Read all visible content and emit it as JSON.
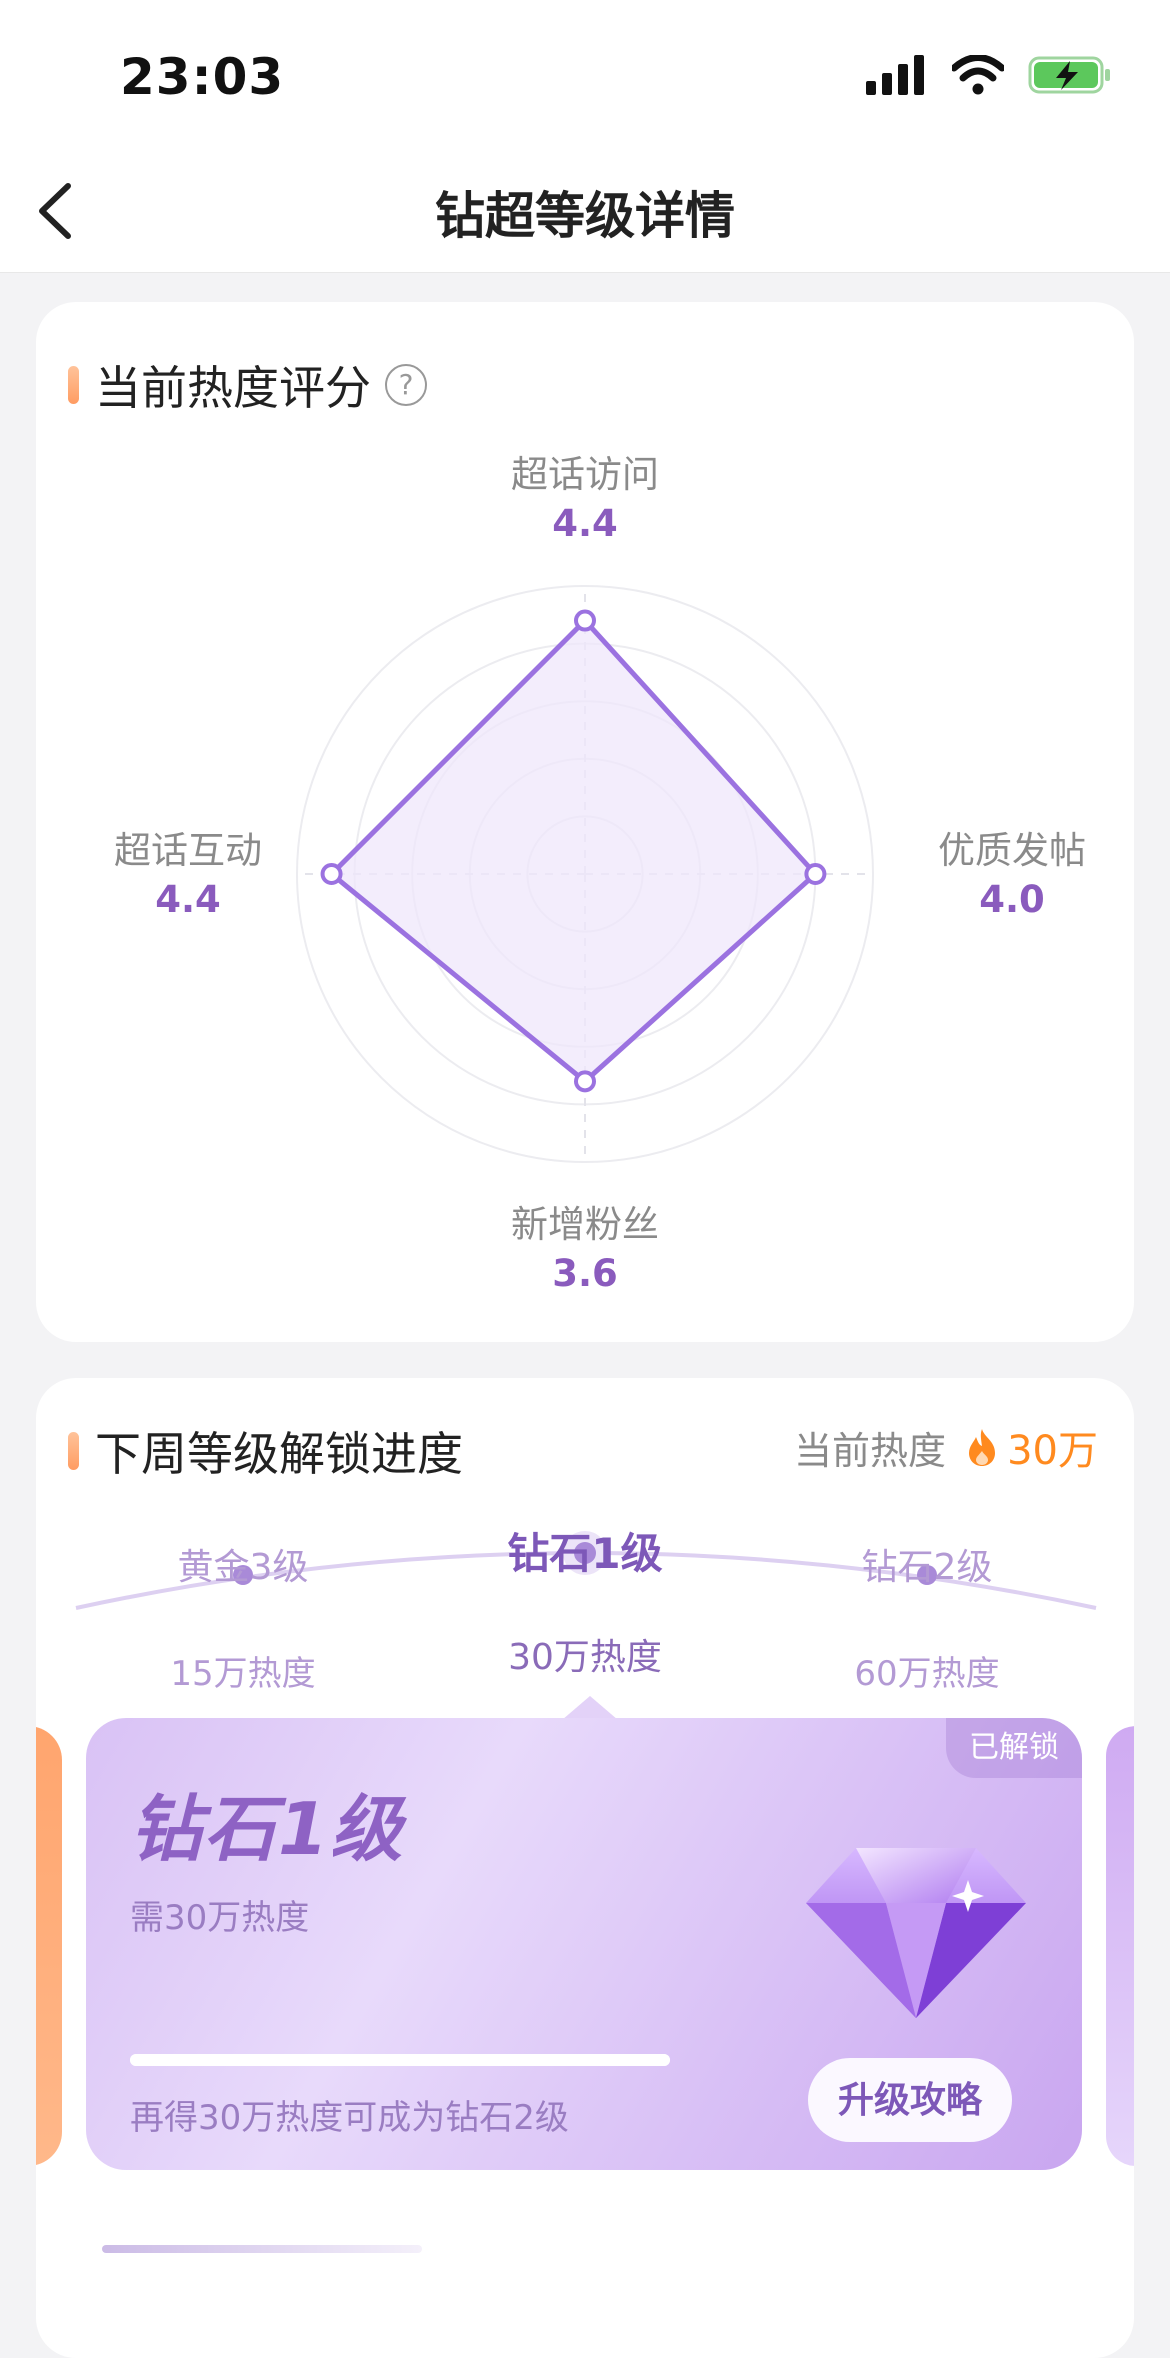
{
  "status_bar": {
    "time": "23:03"
  },
  "nav": {
    "title": "钻超等级详情"
  },
  "heat_score": {
    "title": "当前热度评分",
    "help_symbol": "?",
    "axes": [
      {
        "name": "超话访问",
        "value": "4.4"
      },
      {
        "name": "优质发帖",
        "value": "4.0"
      },
      {
        "name": "新增粉丝",
        "value": "3.6"
      },
      {
        "name": "超话互动",
        "value": "4.4"
      }
    ],
    "radar_max": 5,
    "colors": {
      "line": "#9b72e0",
      "fill": "#efe7fb",
      "value": "#8a5bbd"
    }
  },
  "level_progress": {
    "title": "下周等级解锁进度",
    "current_heat_label": "当前热度",
    "current_heat_value": "30万",
    "levels": [
      {
        "name": "黄金3级",
        "requirement": "15万热度"
      },
      {
        "name": "钻石1级",
        "requirement": "30万热度"
      },
      {
        "name": "钻石2级",
        "requirement": "60万热度"
      }
    ],
    "card": {
      "badge": "已解锁",
      "title": "钻石1级",
      "subtitle": "需30万热度",
      "progress": 1.0,
      "footer": "再得30万热度可成为钻石2级",
      "button": "升级攻略"
    }
  }
}
